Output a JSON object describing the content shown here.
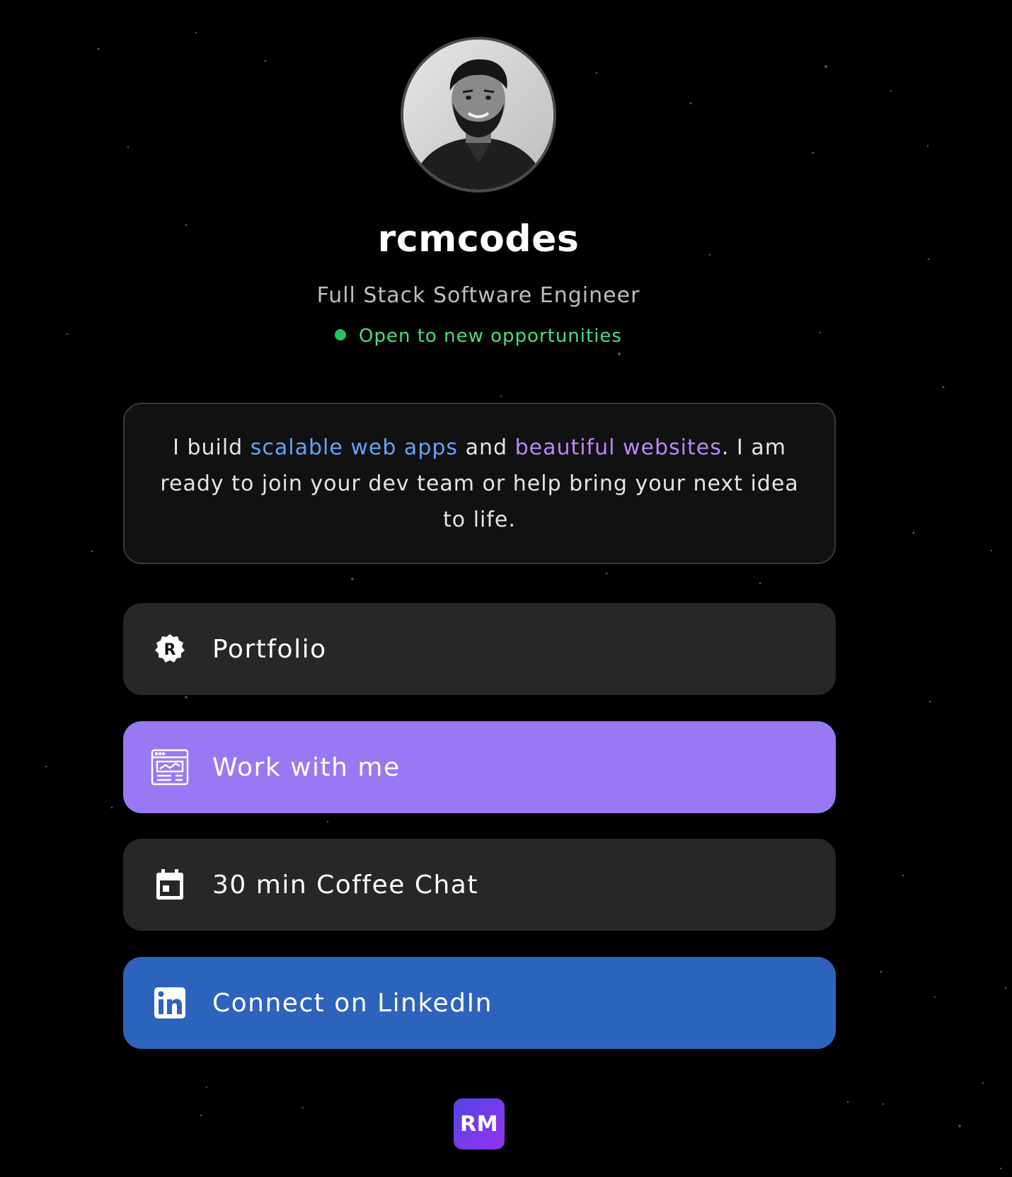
{
  "profile": {
    "username": "rcmcodes",
    "title": "Full Stack Software Engineer",
    "status": "Open to new opportunities",
    "status_color": "#22c55e"
  },
  "bio": {
    "prefix": "I build ",
    "highlight_1": "scalable web apps",
    "middle": " and ",
    "highlight_2": "beautiful websites",
    "suffix": ". I am ready to join your dev team or help bring your next idea to life.",
    "highlight_1_color": "#60a5fa",
    "highlight_2_color": "#c084fc"
  },
  "links": [
    {
      "label": "Portfolio",
      "icon": "portfolio-badge-icon",
      "color": "#272727"
    },
    {
      "label": "Work with me",
      "icon": "browser-window-icon",
      "color": "#9b78f3"
    },
    {
      "label": "30 min Coffee Chat",
      "icon": "calendar-icon",
      "color": "#272727"
    },
    {
      "label": "Connect on LinkedIn",
      "icon": "linkedin-icon",
      "color": "#2c63bd"
    }
  ],
  "footer": {
    "logo_text": "RM"
  }
}
